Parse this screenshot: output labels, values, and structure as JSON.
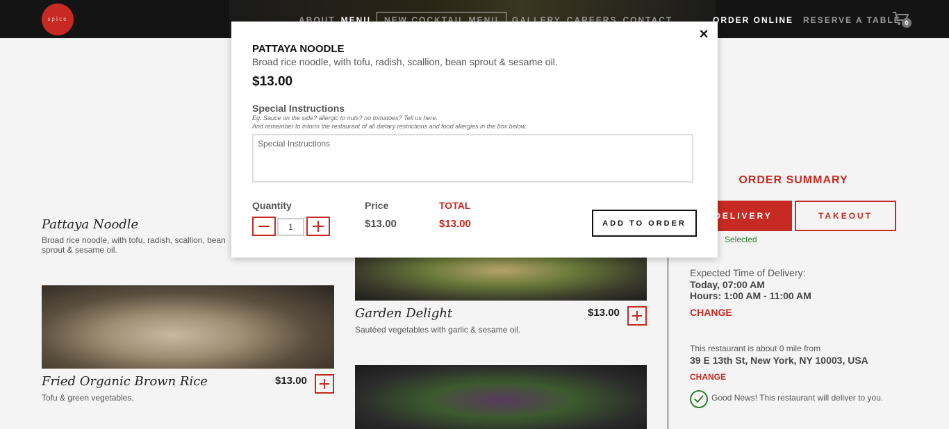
{
  "nav": {
    "logo_text": "spice",
    "items": [
      "ABOUT",
      "MENU",
      "NEW COCKTAIL MENU",
      "GALLERY",
      "CAREERS",
      "CONTACT"
    ],
    "order_online": "ORDER ONLINE",
    "reserve": "RESERVE A TABLE",
    "cart_count": "0"
  },
  "menu": {
    "items": [
      {
        "title": "Pattaya Noodle",
        "desc": "Broad rice noodle, with tofu, radish, scallion, bean sprout & sesame oil.",
        "price": ""
      },
      {
        "title": "Garden Delight",
        "desc": "Sautéed vegetables with garlic & sesame oil.",
        "price": "$13.00"
      },
      {
        "title": "Fried Organic Brown Rice",
        "desc": "Tofu & green vegetables.",
        "price": "$13.00"
      }
    ]
  },
  "summary": {
    "title": "ORDER SUMMARY",
    "delivery": "DELIVERY",
    "takeout": "TAKEOUT",
    "selected": "Selected",
    "expected_label": "Expected Time of Delivery:",
    "expected_time": "Today, 07:00 AM",
    "hours": "Hours: 1:00 AM - 11:00 AM",
    "change": "CHANGE",
    "distance": "This restaurant is about 0 mile from",
    "address": "39 E 13th St, New York, NY 10003, USA",
    "change_small": "CHANGE",
    "good_news": "Good News! This restaurant will deliver to you."
  },
  "modal": {
    "close": "×",
    "title": "PATTAYA NOODLE",
    "description": "Broad rice noodle, with tofu, radish, scallion, bean sprout & sesame oil.",
    "price": "$13.00",
    "special_label": "Special Instructions",
    "hint1": "Eg. Sauce on the side? allergic to nuts? no tomatoes? Tell us here.",
    "hint2": "And remember to inform the restaurant of all dietary restrictions and food allergies in the box below.",
    "special_placeholder": "Special Instructions",
    "quantity_label": "Quantity",
    "quantity_value": "1",
    "price_label": "Price",
    "price_value": "$13.00",
    "total_label": "TOTAL",
    "total_value": "$13.00",
    "add_button": "ADD TO ORDER"
  },
  "colors": {
    "accent": "#c62a22",
    "success": "#2e7d32"
  }
}
